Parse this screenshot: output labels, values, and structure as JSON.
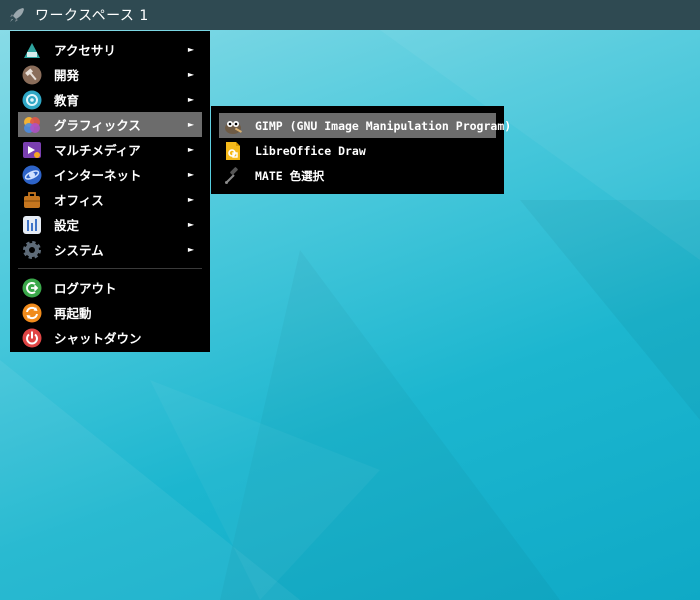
{
  "topbar": {
    "workspace": "ワークスペース 1",
    "logo_icon": "rocket-icon"
  },
  "menu": {
    "items": [
      {
        "label": "アクセサリ",
        "icon": "accessories-icon",
        "color": "#2fa5a0"
      },
      {
        "label": "開発",
        "icon": "hammer-icon",
        "color": "#8a6d5a"
      },
      {
        "label": "教育",
        "icon": "education-icon",
        "color": "#2fa7c5"
      },
      {
        "label": "グラフィックス",
        "icon": "graphics-icon",
        "color": "#e0584a"
      },
      {
        "label": "マルチメディア",
        "icon": "multimedia-icon",
        "color": "#7a3fb0"
      },
      {
        "label": "インターネット",
        "icon": "globe-icon",
        "color": "#2d63c8"
      },
      {
        "label": "オフィス",
        "icon": "briefcase-icon",
        "color": "#c5761f"
      },
      {
        "label": "設定",
        "icon": "settings-icon",
        "color": "#e6ecf4"
      },
      {
        "label": "システム",
        "icon": "gear-icon",
        "color": "#5e6b78"
      }
    ],
    "actions": [
      {
        "label": "ログアウト",
        "icon": "logout-icon",
        "color": "#3aa84a"
      },
      {
        "label": "再起動",
        "icon": "restart-icon",
        "color": "#f08b1c"
      },
      {
        "label": "シャットダウン",
        "icon": "power-icon",
        "color": "#e04545"
      }
    ],
    "arrow": "►"
  },
  "submenu": {
    "items": [
      {
        "label": "GIMP (GNU Image Manipulation Program)",
        "icon": "gimp-icon"
      },
      {
        "label": "LibreOffice Draw",
        "icon": "libreoffice-draw-icon"
      },
      {
        "label": "MATE 色選択",
        "icon": "color-picker-icon"
      }
    ]
  }
}
